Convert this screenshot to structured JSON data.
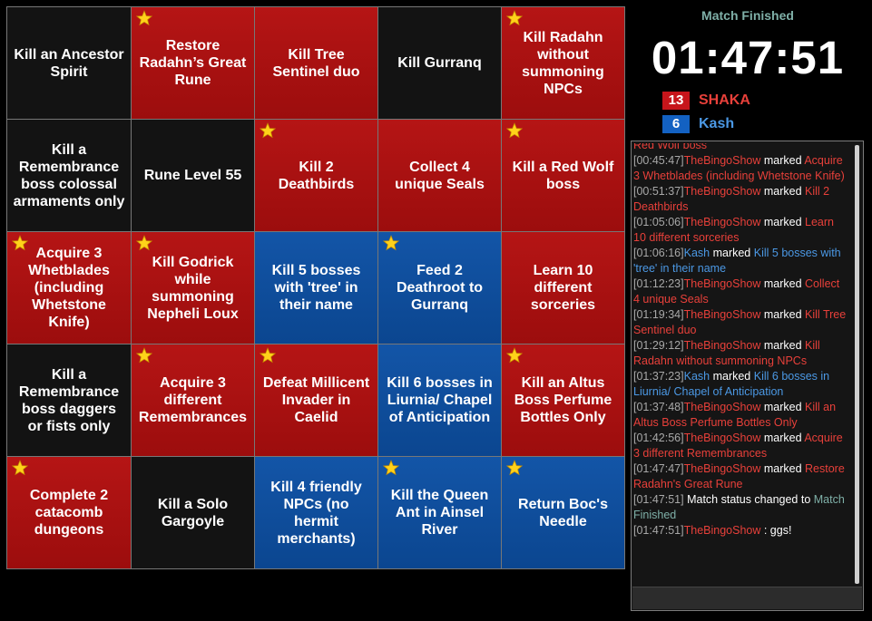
{
  "board": {
    "cells": [
      {
        "label": "Kill an Ancestor Spirit",
        "color": "black",
        "star": false
      },
      {
        "label": "Restore Radahn’s Great Rune",
        "color": "red",
        "star": true
      },
      {
        "label": "Kill Tree Sentinel duo",
        "color": "red",
        "star": false
      },
      {
        "label": "Kill Gurranq",
        "color": "black",
        "star": false
      },
      {
        "label": "Kill Radahn without summoning NPCs",
        "color": "red",
        "star": true
      },
      {
        "label": "Kill a Remembrance boss colossal armaments only",
        "color": "black",
        "star": false
      },
      {
        "label": "Rune Level 55",
        "color": "black",
        "star": false
      },
      {
        "label": "Kill 2 Deathbirds",
        "color": "red",
        "star": true
      },
      {
        "label": "Collect 4 unique Seals",
        "color": "red",
        "star": false
      },
      {
        "label": "Kill a Red Wolf boss",
        "color": "red",
        "star": true
      },
      {
        "label": "Acquire 3 Whetblades (including Whetstone Knife)",
        "color": "red",
        "star": true
      },
      {
        "label": "Kill Godrick while summoning Nepheli Loux",
        "color": "red",
        "star": true
      },
      {
        "label": "Kill 5 bosses with 'tree' in their name",
        "color": "blue",
        "star": false
      },
      {
        "label": "Feed 2 Deathroot to Gurranq",
        "color": "blue",
        "star": true
      },
      {
        "label": "Learn 10 different sorceries",
        "color": "red",
        "star": false
      },
      {
        "label": "Kill a Remembrance boss daggers or fists only",
        "color": "black",
        "star": false
      },
      {
        "label": "Acquire 3 different Remembrances",
        "color": "red",
        "star": true
      },
      {
        "label": "Defeat Millicent Invader in Caelid",
        "color": "red",
        "star": true
      },
      {
        "label": "Kill 6 bosses in Liurnia/ Chapel of Anticipation",
        "color": "blue",
        "star": false
      },
      {
        "label": "Kill an Altus Boss Perfume Bottles Only",
        "color": "red",
        "star": true
      },
      {
        "label": "Complete 2 catacomb dungeons",
        "color": "red",
        "star": true
      },
      {
        "label": "Kill a Solo Gargoyle",
        "color": "black",
        "star": false
      },
      {
        "label": "Kill 4 friendly NPCs (no hermit merchants)",
        "color": "blue",
        "star": false
      },
      {
        "label": "Kill the Queen Ant in Ainsel River",
        "color": "blue",
        "star": true
      },
      {
        "label": "Return Boc's Needle",
        "color": "blue",
        "star": true
      }
    ]
  },
  "status": "Match Finished",
  "timer": "01:47:51",
  "teams": {
    "red": {
      "score": "13",
      "name": "SHAKA",
      "color": "#c7151b"
    },
    "blue": {
      "score": "6",
      "name": "Kash",
      "color": "#1361c2"
    }
  },
  "log": [
    {
      "ts": "",
      "player": "",
      "player_team": "",
      "action": "",
      "target": "Red Wolf boss",
      "target_team": "red"
    },
    {
      "ts": "[00:45:47]",
      "player": "TheBingoShow",
      "player_team": "red",
      "action": " marked ",
      "target": "Acquire 3 Whetblades (including Whetstone Knife)",
      "target_team": "red"
    },
    {
      "ts": "[00:51:37]",
      "player": "TheBingoShow",
      "player_team": "red",
      "action": " marked ",
      "target": "Kill 2 Deathbirds",
      "target_team": "red"
    },
    {
      "ts": "[01:05:06]",
      "player": "TheBingoShow",
      "player_team": "red",
      "action": " marked ",
      "target": "Learn 10 different sorceries",
      "target_team": "red"
    },
    {
      "ts": "[01:06:16]",
      "player": "Kash",
      "player_team": "blue",
      "action": " marked ",
      "target": "Kill 5 bosses with 'tree' in their name",
      "target_team": "blue"
    },
    {
      "ts": "[01:12:23]",
      "player": "TheBingoShow",
      "player_team": "red",
      "action": " marked ",
      "target": "Collect 4 unique Seals",
      "target_team": "red"
    },
    {
      "ts": "[01:19:34]",
      "player": "TheBingoShow",
      "player_team": "red",
      "action": " marked ",
      "target": "Kill Tree Sentinel duo",
      "target_team": "red"
    },
    {
      "ts": "[01:29:12]",
      "player": "TheBingoShow",
      "player_team": "red",
      "action": " marked ",
      "target": "Kill Radahn without summoning NPCs",
      "target_team": "red"
    },
    {
      "ts": "[01:37:23]",
      "player": "Kash",
      "player_team": "blue",
      "action": " marked ",
      "target": "Kill 6 bosses in Liurnia/ Chapel of Anticipation",
      "target_team": "blue"
    },
    {
      "ts": "[01:37:48]",
      "player": "TheBingoShow",
      "player_team": "red",
      "action": " marked ",
      "target": "Kill an Altus Boss Perfume Bottles Only",
      "target_team": "red"
    },
    {
      "ts": "[01:42:56]",
      "player": "TheBingoShow",
      "player_team": "red",
      "action": " marked ",
      "target": "Acquire 3 different Remembrances",
      "target_team": "red"
    },
    {
      "ts": "[01:47:47]",
      "player": "TheBingoShow",
      "player_team": "red",
      "action": " marked ",
      "target": "Restore Radahn's Great Rune",
      "target_team": "red"
    },
    {
      "ts": "[01:47:51]",
      "player": "",
      "player_team": "",
      "action": " Match status changed to ",
      "target": "Match Finished",
      "target_team": "teal"
    },
    {
      "ts": "[01:47:51]",
      "player": "TheBingoShow",
      "player_team": "red",
      "action": " : ggs!",
      "target": "",
      "target_team": ""
    }
  ],
  "icons": {
    "star": "star-icon"
  }
}
